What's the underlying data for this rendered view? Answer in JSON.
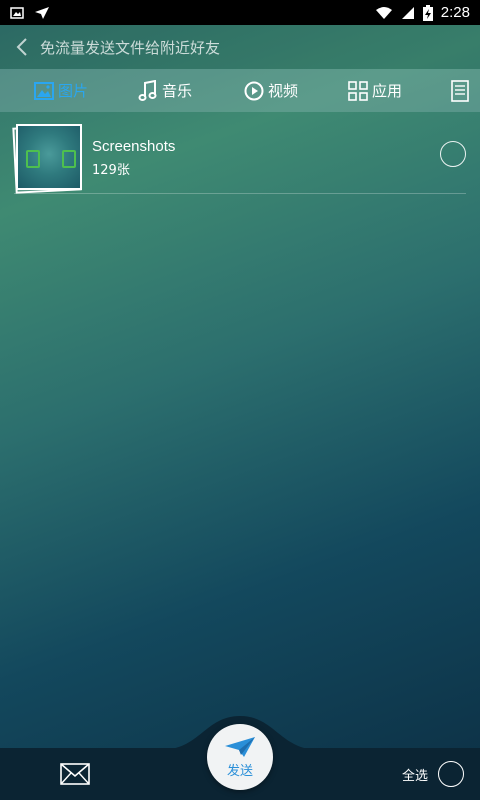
{
  "status_bar": {
    "time": "2:28",
    "icons": [
      "image-notification-icon",
      "app-notification-icon",
      "wifi-icon",
      "signal-icon",
      "battery-icon"
    ]
  },
  "header": {
    "title": "免流量发送文件给附近好友",
    "back_icon": "chevron-left-icon"
  },
  "tabs": [
    {
      "label": "图片",
      "icon": "image-icon",
      "active": true
    },
    {
      "label": "音乐",
      "icon": "music-note-icon",
      "active": false
    },
    {
      "label": "视频",
      "icon": "play-circle-icon",
      "active": false
    },
    {
      "label": "应用",
      "icon": "grid-icon",
      "active": false
    }
  ],
  "albums": [
    {
      "name": "Screenshots",
      "count": "129张",
      "selected": false
    }
  ],
  "bottom": {
    "send_label": "发送",
    "select_all_label": "全选"
  },
  "colors": {
    "accent": "#2aa6f0",
    "send_text": "#2a8fd8",
    "bottom_bar": "#0b2433",
    "status_bar": "#000000"
  }
}
